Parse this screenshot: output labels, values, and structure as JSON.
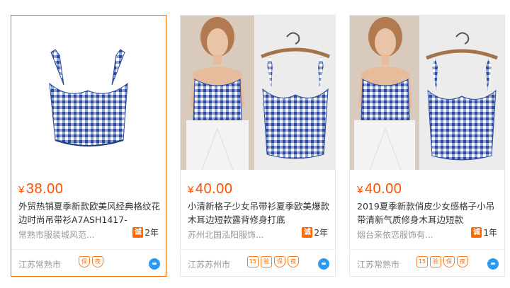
{
  "cards": [
    {
      "currency": "¥",
      "price": "38.00",
      "title": "外贸热销夏季新款欧美风经典格纹花边时尚吊带衫A7ASH1417-",
      "shop": "常熟市服装城风范...",
      "years_icon": "诚",
      "years": "2年",
      "location": "江苏常熟市",
      "badges": [
        "保",
        "夜"
      ]
    },
    {
      "currency": "¥",
      "price": "40.00",
      "title": "小清新格子少女吊带衫夏季欧美爆款木耳边短款露背修身打底",
      "shop": "苏州北国泓阳服饰...",
      "years_icon": "诚",
      "years": "2年",
      "location": "江苏苏州市",
      "badges": [
        "15",
        "验",
        "保",
        "夜"
      ]
    },
    {
      "currency": "¥",
      "price": "40.00",
      "title": "2019夏季新款俏皮少女感格子小吊带清新气质修身木耳边短款",
      "shop": "烟台来依恋服饰有...",
      "years_icon": "诚",
      "years": "1年",
      "location": "江苏常熟市",
      "badges": [
        "15",
        "验",
        "保",
        "夜"
      ]
    }
  ],
  "colors": {
    "price": "#ff5000",
    "active_border": "#ff6a00",
    "gingham_blue": "#3a5aa8",
    "wangwang": "#2c9af2"
  },
  "icons": [
    "chengxintong-icon",
    "wangwang-chat-icon",
    "product-image-top",
    "product-image-model"
  ]
}
